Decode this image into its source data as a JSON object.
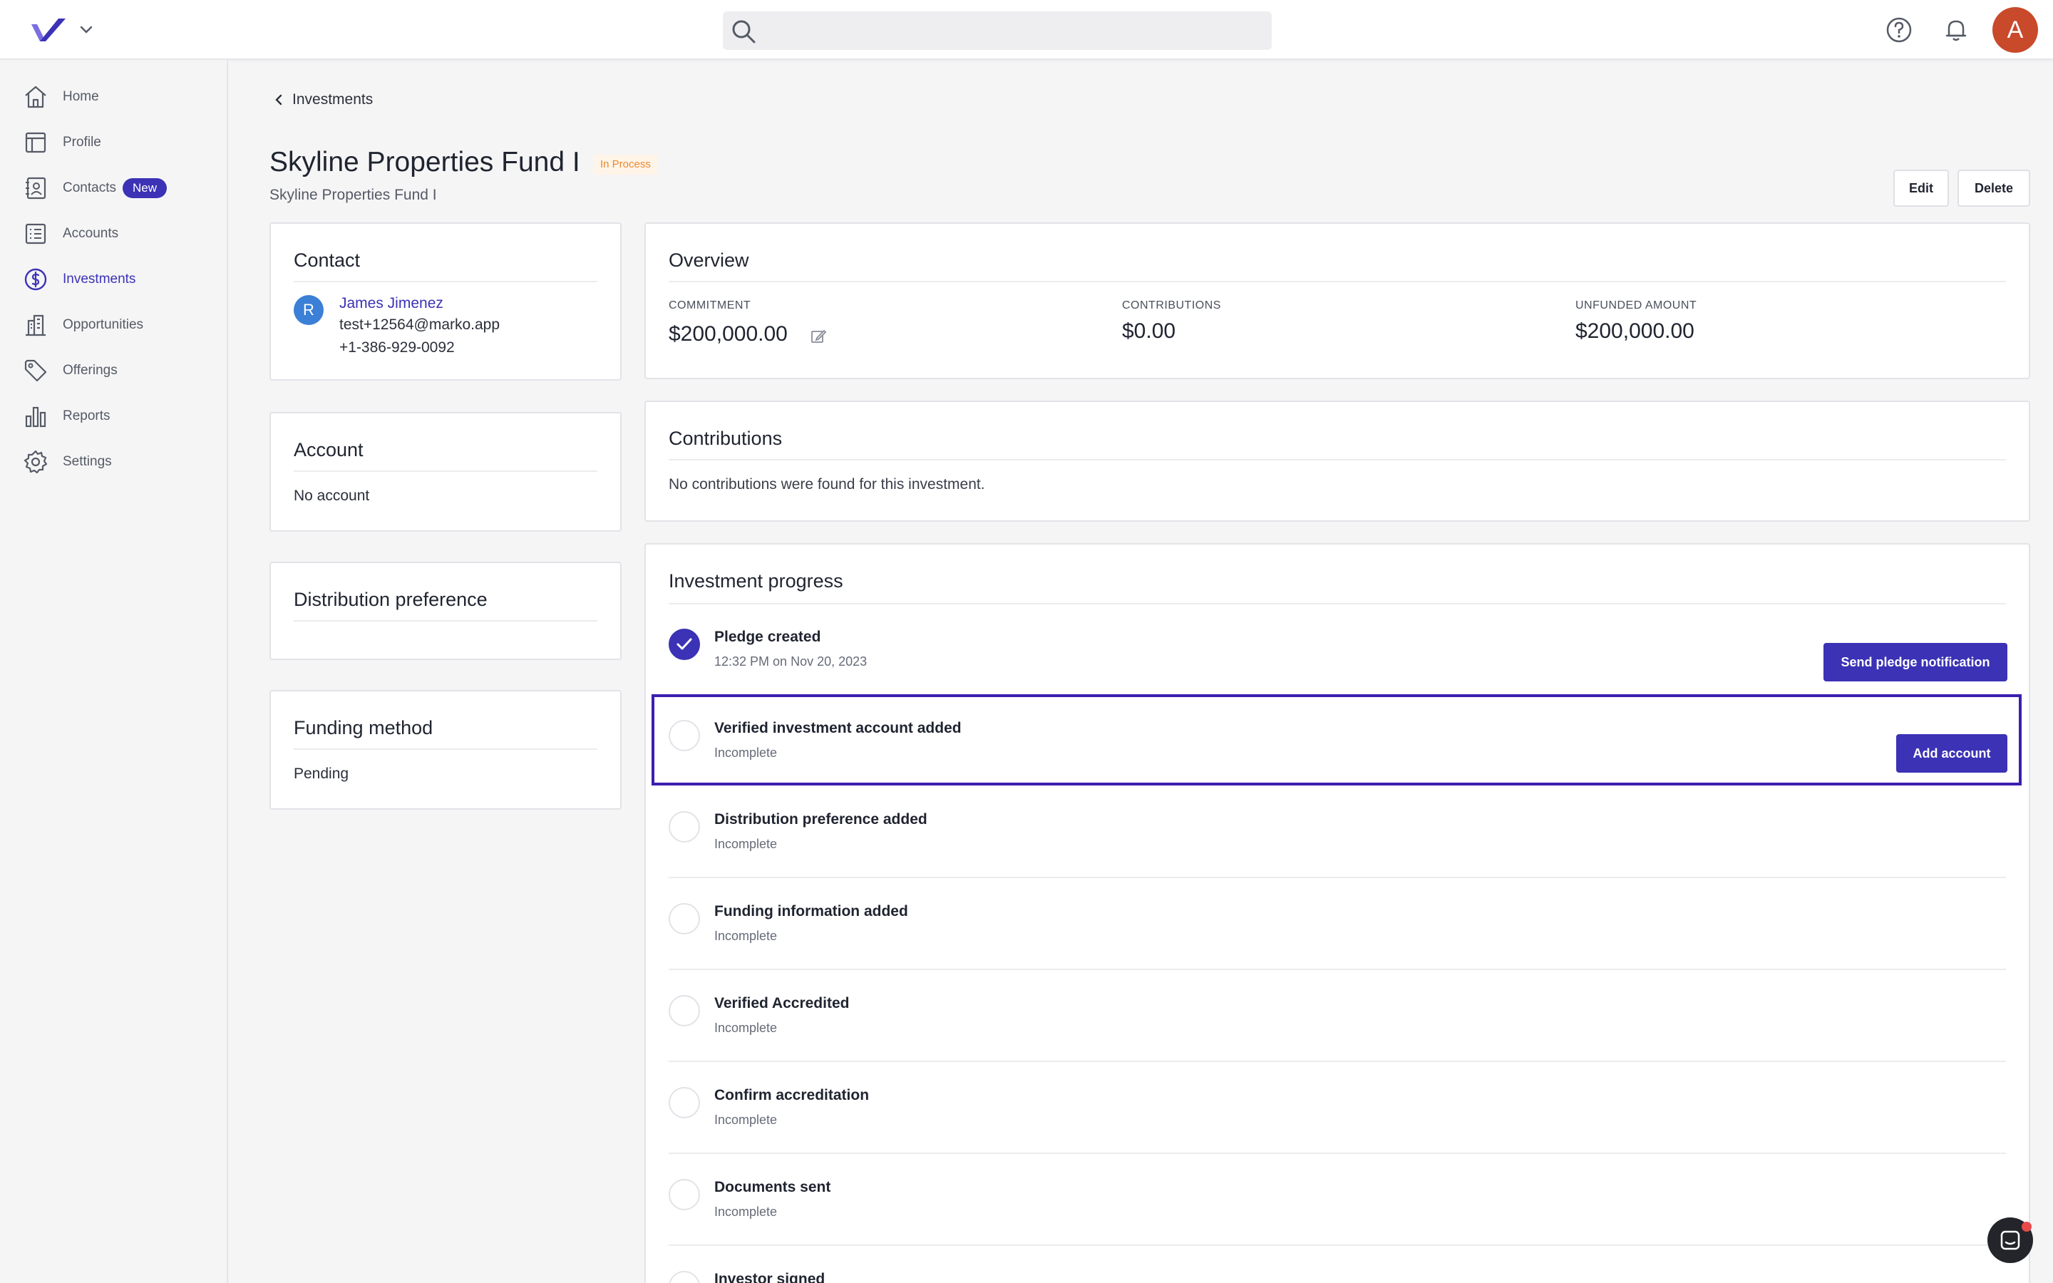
{
  "app": {
    "search": {
      "placeholder": ""
    },
    "avatar_initial": "A",
    "accent_color": "#3b32b5"
  },
  "sidebar": {
    "items": [
      {
        "label": "Home",
        "icon": "home-icon"
      },
      {
        "label": "Profile",
        "icon": "profile-icon"
      },
      {
        "label": "Contacts",
        "icon": "contacts-icon",
        "badge": "New"
      },
      {
        "label": "Accounts",
        "icon": "accounts-icon"
      },
      {
        "label": "Investments",
        "icon": "dollar-icon",
        "active": true
      },
      {
        "label": "Opportunities",
        "icon": "building-icon"
      },
      {
        "label": "Offerings",
        "icon": "tag-icon"
      },
      {
        "label": "Reports",
        "icon": "bar-chart-icon"
      },
      {
        "label": "Settings",
        "icon": "gear-icon"
      }
    ]
  },
  "breadcrumb": {
    "back_label": "Investments"
  },
  "header": {
    "title": "Skyline Properties Fund I",
    "status": "In Process",
    "subtitle": "Skyline Properties Fund I",
    "edit_label": "Edit",
    "delete_label": "Delete"
  },
  "contact_card": {
    "title": "Contact",
    "avatar_initial": "R",
    "name": "James Jimenez",
    "email": "test+12564@marko.app",
    "phone": "+1-386-929-0092"
  },
  "account_card": {
    "title": "Account",
    "value": "No account"
  },
  "distribution_card": {
    "title": "Distribution preference"
  },
  "funding_card": {
    "title": "Funding method",
    "value": "Pending"
  },
  "overview": {
    "title": "Overview",
    "commitment_label": "COMMITMENT",
    "commitment_value": "$200,000.00",
    "contributions_label": "CONTRIBUTIONS",
    "contributions_value": "$0.00",
    "unfunded_label": "UNFUNDED AMOUNT",
    "unfunded_value": "$200,000.00"
  },
  "contributions": {
    "title": "Contributions",
    "empty_text": "No contributions were found for this investment."
  },
  "progress": {
    "title": "Investment progress",
    "steps": [
      {
        "title": "Pledge created",
        "status": "12:32 PM on Nov 20, 2023",
        "done": true,
        "action": "Send pledge notification"
      },
      {
        "title": "Verified investment account added",
        "status": "Incomplete",
        "action": "Add account"
      },
      {
        "title": "Distribution preference added",
        "status": "Incomplete"
      },
      {
        "title": "Funding information added",
        "status": "Incomplete"
      },
      {
        "title": "Verified Accredited",
        "status": "Incomplete"
      },
      {
        "title": "Confirm accreditation",
        "status": "Incomplete"
      },
      {
        "title": "Documents sent",
        "status": "Incomplete"
      },
      {
        "title": "Investor signed",
        "status": ""
      }
    ]
  }
}
